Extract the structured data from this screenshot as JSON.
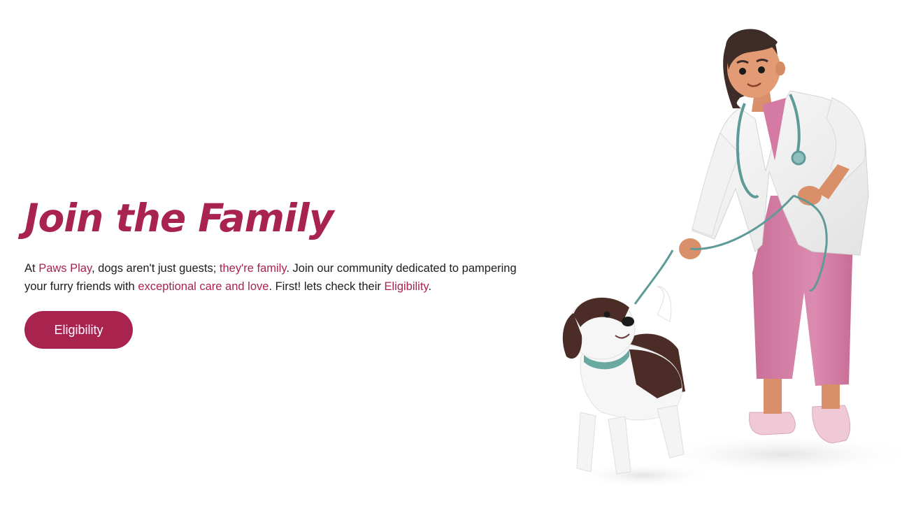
{
  "hero": {
    "title": "Join the Family",
    "description": {
      "t1": "At ",
      "brand": "Paws Play",
      "t2": ", dogs aren't just guests; ",
      "hl_family": "they're family",
      "t3": ". Join our community dedicated to pampering your furry friends with ",
      "hl_care": "exceptional care and love",
      "t4": ". First! lets check their ",
      "hl_eligibility": "Eligibility",
      "t5": "."
    },
    "cta_label": "Eligibility"
  },
  "colors": {
    "accent": "#a8244f",
    "text": "#1c1c1c",
    "background": "#ffffff"
  },
  "illustration": {
    "subject": "veterinarian-walking-dog-illustration"
  }
}
